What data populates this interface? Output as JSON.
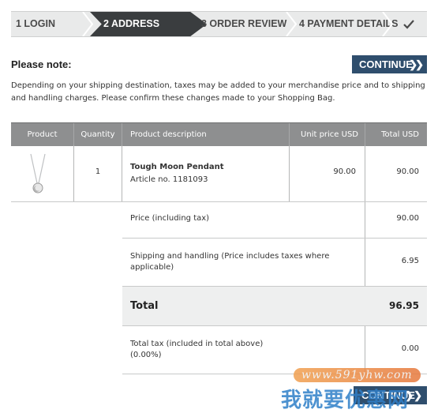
{
  "steps": [
    {
      "label": "1 LOGIN"
    },
    {
      "label": "2 ADDRESS",
      "active": true
    },
    {
      "label": "3 ORDER REVIEW"
    },
    {
      "label": "4 PAYMENT DETAILS"
    }
  ],
  "step_done_icon": "checkmark-icon",
  "notice": {
    "heading": "Please note:",
    "text": "Depending on your shipping destination, taxes may be added to your merchandise price and to shipping and handling charges. Please confirm these changes made to your Shopping Bag."
  },
  "continue_button": {
    "label": "CONTINUE",
    "icon": "double-chevron-right-icon"
  },
  "table": {
    "headers": {
      "product": "Product",
      "quantity": "Quantity",
      "description": "Product description",
      "unit_price": "Unit price USD",
      "total": "Total USD"
    },
    "items": [
      {
        "image": "pendant-necklace-image",
        "quantity": "1",
        "name": "Tough Moon Pendant",
        "article": "Article no. 1181093",
        "unit_price": "90.00",
        "total": "90.00"
      }
    ],
    "summary": {
      "price_label": "Price (including tax)",
      "price_value": "90.00",
      "shipping_label": "Shipping and handling (Price includes taxes where applicable)",
      "shipping_value": "6.95",
      "total_label": "Total",
      "total_value": "96.95",
      "tax_label": "Total tax (included in total above) (0.00%)",
      "tax_value": "0.00"
    }
  },
  "watermark": {
    "url": "www.591yhw.com",
    "text": "我就要优惠网"
  },
  "colors": {
    "accent": "#2f4e6d",
    "active_step": "#3a3d3f",
    "table_header": "#8e8f90"
  }
}
